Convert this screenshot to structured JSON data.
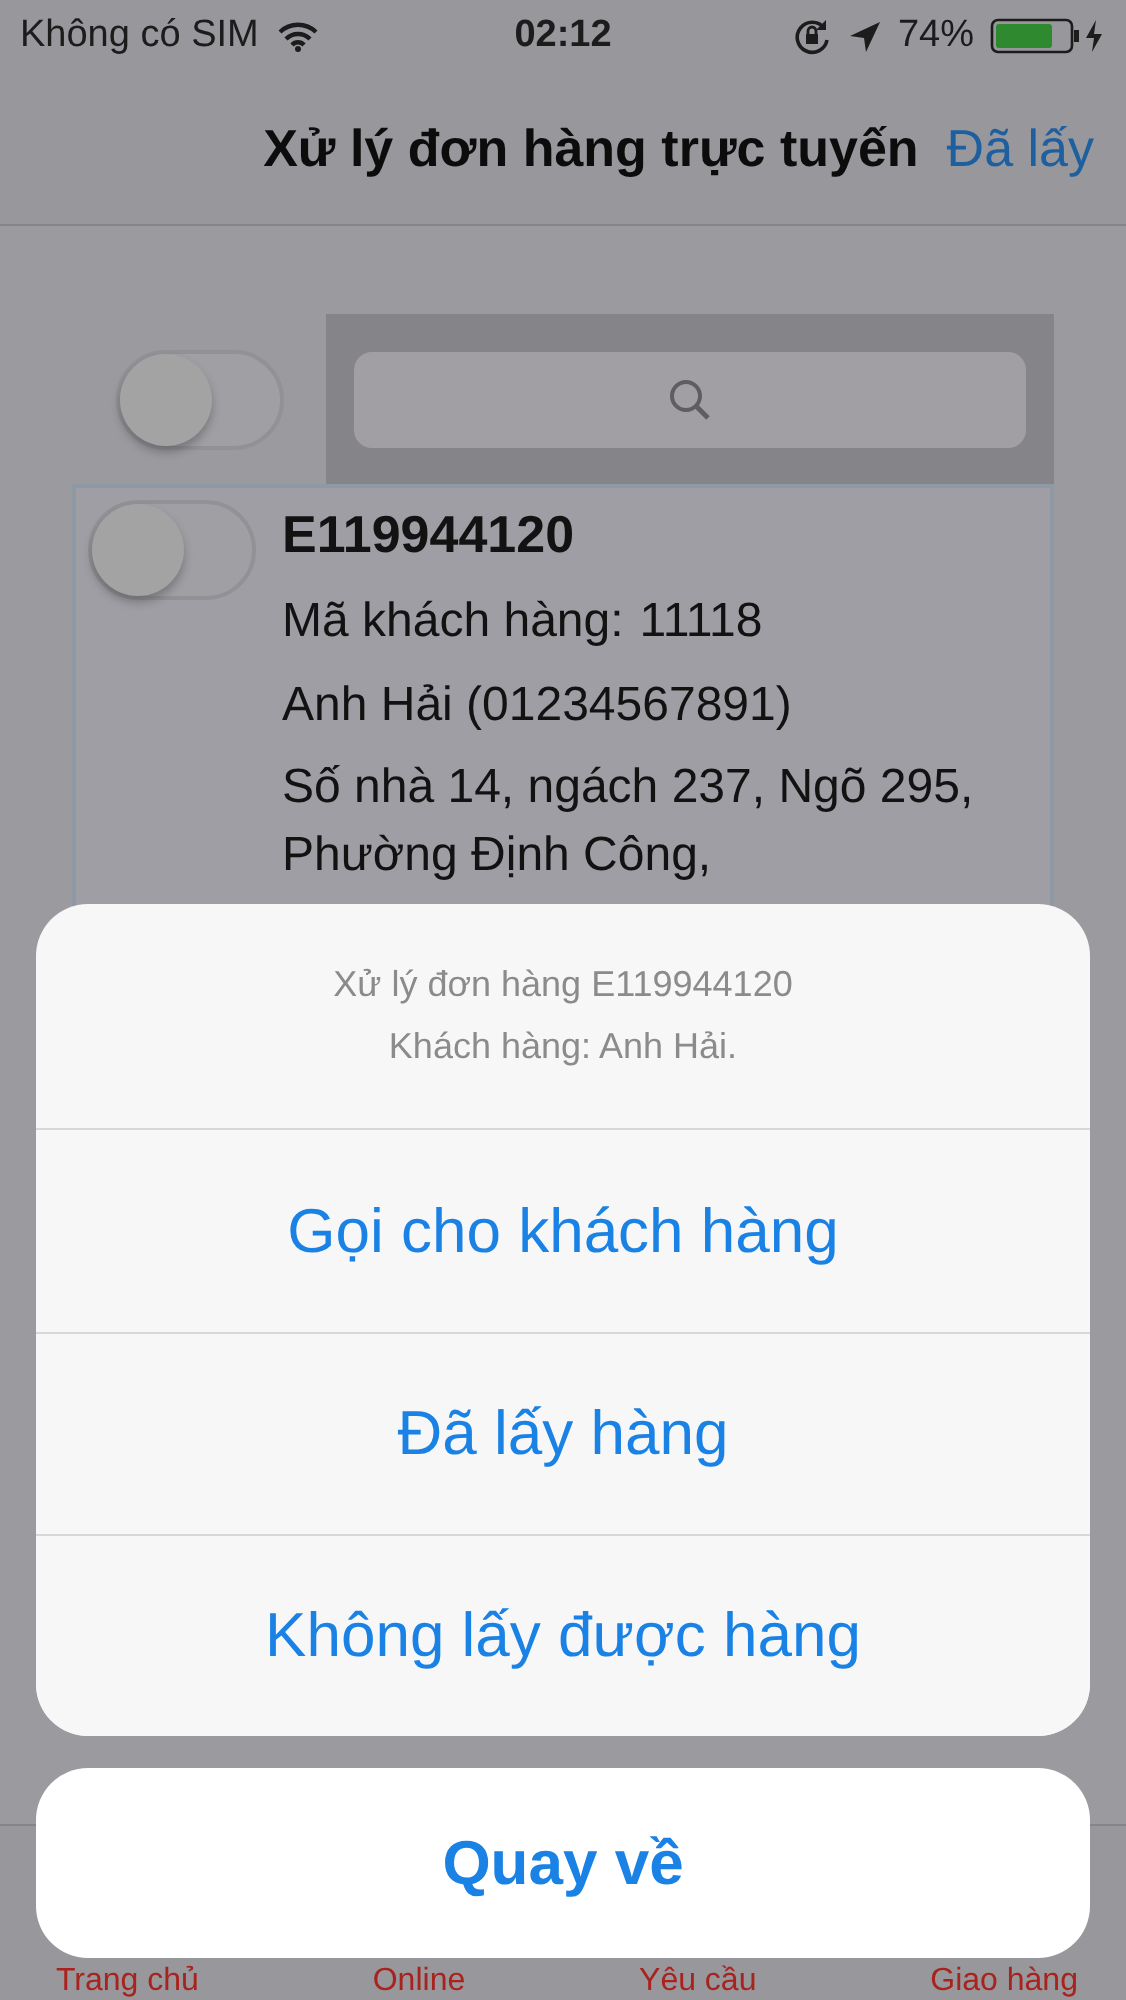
{
  "status_bar": {
    "carrier": "Không có SIM",
    "time": "02:12",
    "battery_percent": "74%"
  },
  "nav_bar": {
    "title": "Xử lý đơn hàng trực tuyến",
    "action": "Đã lấy"
  },
  "select_all_toggle": {
    "on": false
  },
  "orders": [
    {
      "toggle_on": false,
      "code": "E119944120",
      "customer_id_label": "Mã khách hàng:",
      "customer_id": "11118",
      "contact": "Anh Hải (01234567891)",
      "address": "Số nhà 14, ngách 237, Ngõ 295, Phường Định Công,"
    }
  ],
  "tab_bar": {
    "items": [
      {
        "label": "Trang chủ"
      },
      {
        "label": "Online"
      },
      {
        "label": "Yêu cầu"
      },
      {
        "label": "Giao hàng"
      }
    ]
  },
  "action_sheet": {
    "title": "Xử lý đơn hàng E119944120",
    "message": "Khách hàng: Anh Hải.",
    "actions": [
      {
        "label": "Gọi cho khách hàng"
      },
      {
        "label": "Đã lấy hàng"
      },
      {
        "label": "Không lấy được hàng"
      }
    ],
    "cancel": "Quay về"
  }
}
